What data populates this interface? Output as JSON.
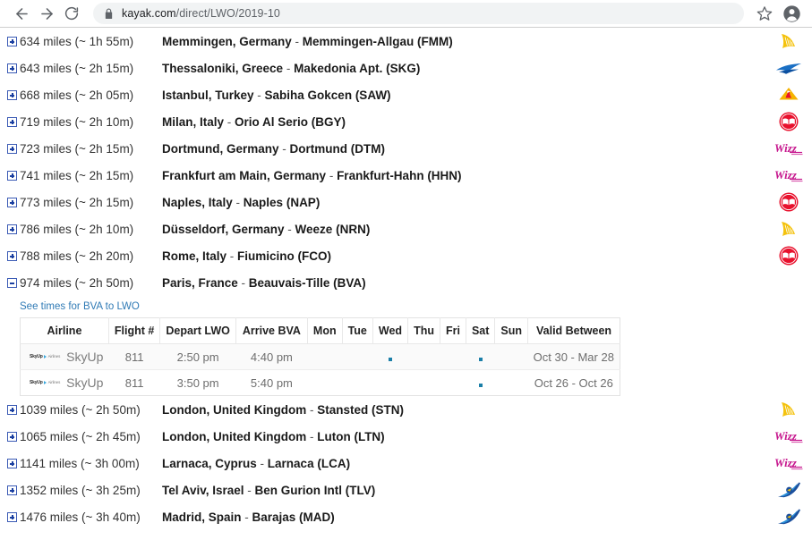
{
  "browser": {
    "back_icon": "arrow-left-icon",
    "forward_icon": "arrow-right-icon",
    "reload_icon": "reload-icon",
    "lock_icon": "lock-icon",
    "url_host": "kayak.com",
    "url_path": "/direct/LWO/2019-10",
    "bookmark_icon": "star-icon",
    "profile_icon": "account-avatar-icon"
  },
  "routes": [
    {
      "expander": "plus",
      "distance": "634 miles (~ 1h 55m)",
      "destination": "Memmingen, Germany",
      "airport": "Memmingen-Allgau (FMM)",
      "airline_logo": "ryanair"
    },
    {
      "expander": "plus",
      "distance": "643 miles (~ 2h 15m)",
      "destination": "Thessaloniki, Greece",
      "airport": "Makedonia Apt. (SKG)",
      "airline_logo": "aegean"
    },
    {
      "expander": "plus",
      "distance": "668 miles (~ 2h 05m)",
      "destination": "Istanbul, Turkey",
      "airport": "Sabiha Gokcen (SAW)",
      "airline_logo": "pegasus"
    },
    {
      "expander": "plus",
      "distance": "719 miles (~ 2h 10m)",
      "destination": "Milan, Italy",
      "airport": "Orio Al Serio (BGY)",
      "airline_logo": "ernest"
    },
    {
      "expander": "plus",
      "distance": "723 miles (~ 2h 15m)",
      "destination": "Dortmund, Germany",
      "airport": "Dortmund (DTM)",
      "airline_logo": "wizzair"
    },
    {
      "expander": "plus",
      "distance": "741 miles (~ 2h 15m)",
      "destination": "Frankfurt am Main, Germany",
      "airport": "Frankfurt-Hahn (HHN)",
      "airline_logo": "wizzair"
    },
    {
      "expander": "plus",
      "distance": "773 miles (~ 2h 15m)",
      "destination": "Naples, Italy",
      "airport": "Naples (NAP)",
      "airline_logo": "ernest"
    },
    {
      "expander": "plus",
      "distance": "786 miles (~ 2h 10m)",
      "destination": "Düsseldorf, Germany",
      "airport": "Weeze (NRN)",
      "airline_logo": "ryanair"
    },
    {
      "expander": "plus",
      "distance": "788 miles (~ 2h 20m)",
      "destination": "Rome, Italy",
      "airport": "Fiumicino (FCO)",
      "airline_logo": "ernest"
    },
    {
      "expander": "minus",
      "distance": "974 miles (~ 2h 50m)",
      "destination": "Paris, France",
      "airport": "Beauvais-Tille (BVA)",
      "airline_logo": "none"
    },
    {
      "expander": "plus",
      "distance": "1039 miles (~ 2h 50m)",
      "destination": "London, United Kingdom",
      "airport": "Stansted (STN)",
      "airline_logo": "ryanair"
    },
    {
      "expander": "plus",
      "distance": "1065 miles (~ 2h 45m)",
      "destination": "London, United Kingdom",
      "airport": "Luton (LTN)",
      "airline_logo": "wizzair"
    },
    {
      "expander": "plus",
      "distance": "1141 miles (~ 3h 00m)",
      "destination": "Larnaca, Cyprus",
      "airport": "Larnaca (LCA)",
      "airline_logo": "wizzair"
    },
    {
      "expander": "plus",
      "distance": "1352 miles (~ 3h 25m)",
      "destination": "Tel Aviv, Israel",
      "airport": "Ben Gurion Intl (TLV)",
      "airline_logo": "uia"
    },
    {
      "expander": "plus",
      "distance": "1476 miles (~ 3h 40m)",
      "destination": "Madrid, Spain",
      "airport": "Barajas (MAD)",
      "airline_logo": "uia"
    }
  ],
  "expanded_panel": {
    "link_label": "See times for BVA to LWO",
    "columns": [
      "Airline",
      "Flight #",
      "Depart LWO",
      "Arrive BVA",
      "Mon",
      "Tue",
      "Wed",
      "Thu",
      "Fri",
      "Sat",
      "Sun",
      "Valid Between"
    ],
    "rows": [
      {
        "airline_logo": "skyup",
        "airline_mark_word": "SkyUp",
        "airline_mark_sub": "Airlines",
        "airline": "SkyUp",
        "flight": "811",
        "depart": "2:50 pm",
        "arrive": "4:40 pm",
        "days": [
          false,
          false,
          true,
          false,
          false,
          true,
          false
        ],
        "valid": "Oct 30 - Mar 28"
      },
      {
        "airline_logo": "skyup",
        "airline_mark_word": "SkyUp",
        "airline_mark_sub": "Airlines",
        "airline": "SkyUp",
        "flight": "811",
        "depart": "3:50 pm",
        "arrive": "5:40 pm",
        "days": [
          false,
          false,
          false,
          false,
          false,
          true,
          false
        ],
        "valid": "Oct 26 - Oct 26"
      }
    ]
  },
  "colors": {
    "link": "#2f7ab5",
    "expander": "#3b5bb5",
    "dot": "#1b7fa8",
    "ryanair": "#f1c40f",
    "wizzair": "#c6168d",
    "ernest": "#e8112d",
    "uia": "#1b4f9c",
    "aegean": "#0a4fa0",
    "pegasus": "#f5b301"
  }
}
